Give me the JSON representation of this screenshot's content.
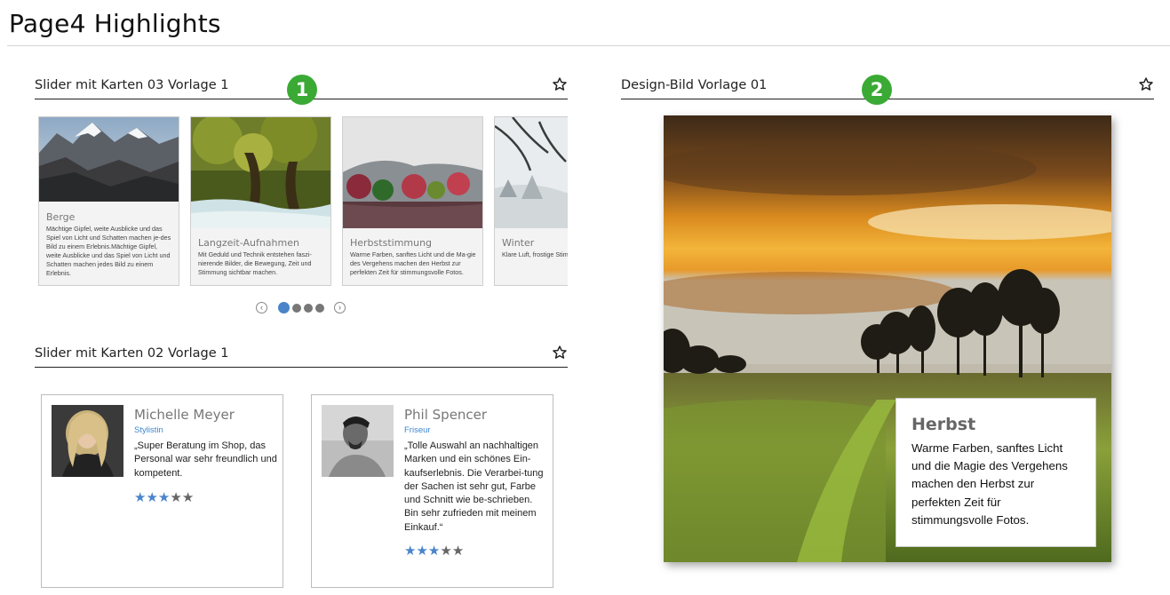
{
  "page": {
    "title": "Page4 Highlights"
  },
  "sections": {
    "slider03": {
      "title": "Slider mit Karten 03 Vorlage 1",
      "badge": "1"
    },
    "design": {
      "title": "Design-Bild Vorlage 01",
      "badge": "2"
    },
    "slider02": {
      "title": "Slider mit Karten 02 Vorlage 1"
    }
  },
  "cards03": [
    {
      "title": "Berge",
      "text": "Mächtige Gipfel, weite Ausblicke und das Spiel von Licht und Schatten machen je-des Bild zu einem Erlebnis.Mächtige Gipfel, weite Ausblicke und das Spiel von Licht und Schatten machen jedes Bild zu einem Erlebnis."
    },
    {
      "title": "Langzeit-Aufnahmen",
      "text": "Mit Geduld und Technik entstehen faszi-nierende Bilder, die Bewegung, Zeit und Stimmung sichtbar machen."
    },
    {
      "title": "Herbststimmung",
      "text": "Warme Farben, sanftes Licht und die Ma-gie des Vergehens machen den Herbst zur perfekten Zeit für stimmungsvolle Fotos."
    },
    {
      "title": "Winter",
      "text": "Klare Luft, frostige Stim schneite Landschaften eigene, ruhige Atmosp"
    }
  ],
  "pager": {
    "prev_icon": "chevron-left-icon",
    "next_icon": "chevron-right-icon",
    "dots": 4,
    "active": 0
  },
  "testimonials": [
    {
      "name": "Michelle Meyer",
      "role": "Stylistin",
      "quote": "„Super Beratung im Shop, das Personal war sehr freundlich und kompetent.",
      "rating": 3,
      "max": 5
    },
    {
      "name": "Phil Spencer",
      "role": "Friseur",
      "quote": "„Tolle Auswahl an nachhaltigen Marken und ein schönes Ein-kaufserlebnis. Die Verarbei-tung der Sachen ist sehr gut, Farbe und Schnitt wie be-schrieben. Bin sehr zufrieden mit meinem Einkauf.“",
      "rating": 3,
      "max": 5
    }
  ],
  "design_image": {
    "title": "Herbst",
    "text": "Warme Farben, sanftes Licht und die Magie des Vergehens machen den Herbst zur perfekten Zeit für stimmungsvolle Fotos."
  },
  "colors": {
    "badge": "#3aaa35",
    "accent": "#4a84c9",
    "role": "#3e86d1"
  },
  "icons": {
    "favorite": "star-outline-icon",
    "rating": "star-icon"
  }
}
